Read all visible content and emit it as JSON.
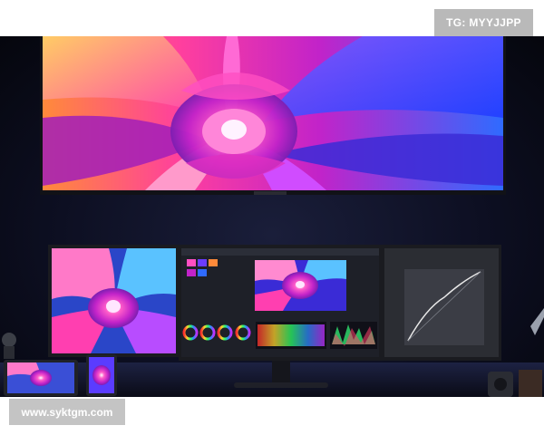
{
  "watermarks": {
    "top_right": "TG: MYYJJPP",
    "bottom_left": "www.syktgm.com"
  },
  "colors": {
    "background": "#0d0f22",
    "flower_pink": "#ff3fb0",
    "flower_magenta": "#c223c9",
    "flower_orange": "#ff8a3a",
    "flower_blue": "#2f6bff",
    "monitor_frame": "#1a1b20"
  },
  "icons": [
    "flower-wallpaper",
    "color-wheel",
    "curve-graph"
  ]
}
